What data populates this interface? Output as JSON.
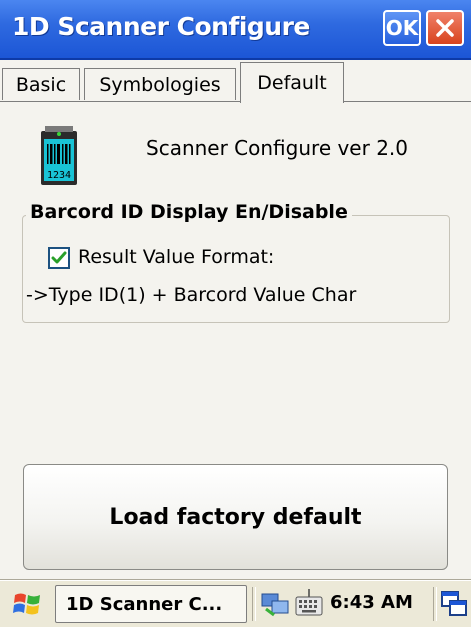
{
  "window": {
    "title": "1D Scanner Configure",
    "ok_label": "OK"
  },
  "tabs": [
    {
      "label": "Basic",
      "active": false
    },
    {
      "label": "Symbologies",
      "active": false
    },
    {
      "label": "Default",
      "active": true
    }
  ],
  "default_tab": {
    "icon_text": "1234",
    "version_text": "Scanner Configure ver 2.0",
    "group_title": "Barcord ID Display En/Disable",
    "checkbox_label": "Result Value Format:",
    "checkbox_checked": true,
    "type_text": "->Type ID(1) + Barcord Value Char",
    "load_button_label": "Load factory default"
  },
  "taskbar": {
    "task_label": "1D Scanner C...",
    "clock": "6:43 AM"
  },
  "colors": {
    "titlebar": "#2f6ae0",
    "ok_button": "#2660dd",
    "close_button": "#d8431e",
    "scanner_screen": "#19c3d6",
    "check_mark": "#2aa02a"
  },
  "icons": {
    "start": "windows-flag-icon",
    "network": "network-icon",
    "keyboard": "keyboard-icon",
    "windows": "window-switch-icon",
    "close": "close-icon",
    "scanner": "barcode-scanner-icon"
  }
}
